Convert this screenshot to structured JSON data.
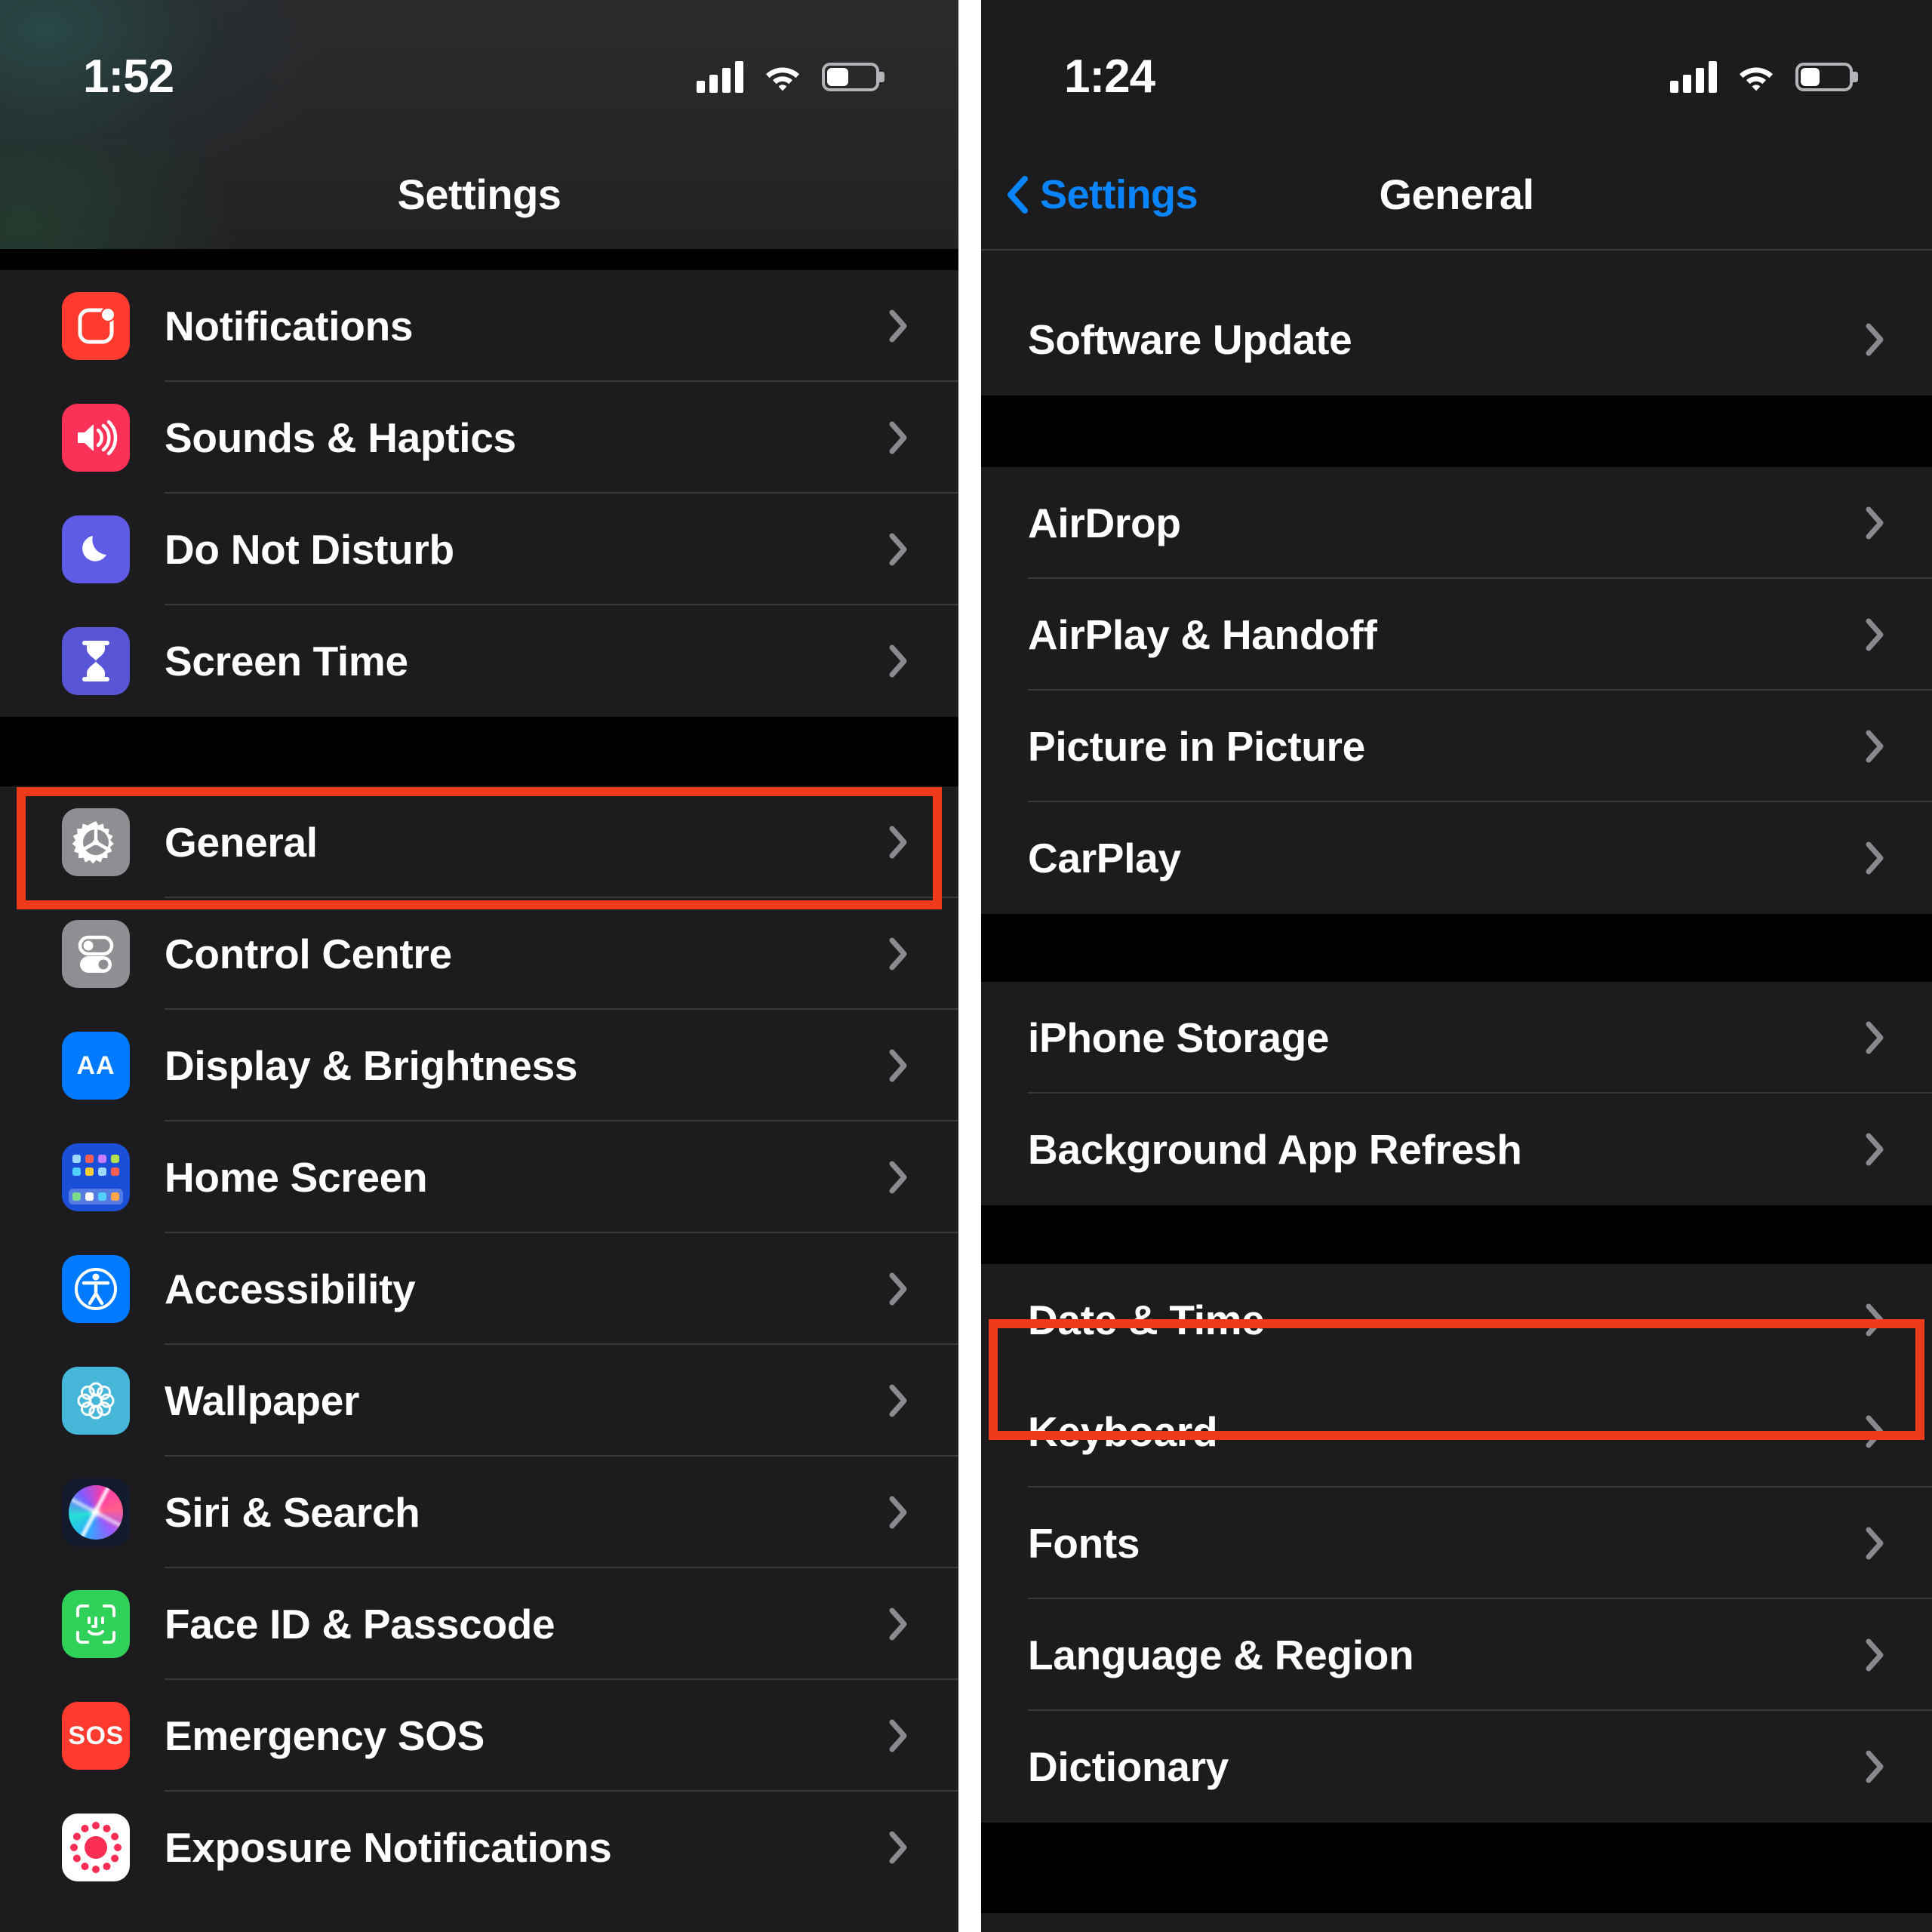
{
  "theme": {
    "accent_blue": "#0a84ff",
    "highlight_red": "#ee3b1c",
    "row_bg": "#1c1c1e",
    "gap_bg": "#000000",
    "label_white": "#ffffff"
  },
  "left_phone": {
    "status_bar": {
      "time": "1:52",
      "cellular": "cellular-bars-icon",
      "wifi": "wifi-icon",
      "battery": "battery-icon",
      "battery_level": 45
    },
    "nav": {
      "title": "Settings"
    },
    "sections": [
      {
        "rows": [
          {
            "label": "Notifications",
            "icon": "notifications-icon",
            "icon_class": "ic-notifications"
          },
          {
            "label": "Sounds & Haptics",
            "icon": "speaker-icon",
            "icon_class": "ic-sounds"
          },
          {
            "label": "Do Not Disturb",
            "icon": "moon-icon",
            "icon_class": "ic-dnd"
          },
          {
            "label": "Screen Time",
            "icon": "hourglass-icon",
            "icon_class": "ic-screentime"
          }
        ]
      },
      {
        "rows": [
          {
            "label": "General",
            "icon": "gear-icon",
            "icon_class": "ic-general",
            "highlighted": true
          },
          {
            "label": "Control Centre",
            "icon": "toggles-icon",
            "icon_class": "ic-control"
          },
          {
            "label": "Display & Brightness",
            "icon": "aa-text-icon",
            "icon_class": "ic-display"
          },
          {
            "label": "Home Screen",
            "icon": "app-grid-icon",
            "icon_class": "ic-homescreen"
          },
          {
            "label": "Accessibility",
            "icon": "accessibility-icon",
            "icon_class": "ic-accessibility"
          },
          {
            "label": "Wallpaper",
            "icon": "flower-icon",
            "icon_class": "ic-wallpaper"
          },
          {
            "label": "Siri & Search",
            "icon": "siri-orb-icon",
            "icon_class": "ic-siri"
          },
          {
            "label": "Face ID & Passcode",
            "icon": "face-id-icon",
            "icon_class": "ic-faceid"
          },
          {
            "label": "Emergency SOS",
            "icon": "sos-icon",
            "icon_class": "ic-sos"
          },
          {
            "label": "Exposure Notifications",
            "icon": "exposure-icon",
            "icon_class": "ic-exposure"
          }
        ]
      }
    ]
  },
  "right_phone": {
    "status_bar": {
      "time": "1:24",
      "cellular": "cellular-bars-icon",
      "wifi": "wifi-icon",
      "battery": "battery-icon",
      "battery_level": 40
    },
    "nav": {
      "back_label": "Settings",
      "title": "General",
      "back_icon": "chevron-left-icon"
    },
    "sections": [
      {
        "rows": [
          {
            "label": "Software Update"
          }
        ]
      },
      {
        "rows": [
          {
            "label": "AirDrop"
          },
          {
            "label": "AirPlay & Handoff"
          },
          {
            "label": "Picture in Picture"
          },
          {
            "label": "CarPlay"
          }
        ]
      },
      {
        "rows": [
          {
            "label": "iPhone Storage"
          },
          {
            "label": "Background App Refresh"
          }
        ]
      },
      {
        "rows": [
          {
            "label": "Date & Time",
            "highlighted": true
          },
          {
            "label": "Keyboard"
          },
          {
            "label": "Fonts"
          },
          {
            "label": "Language & Region"
          },
          {
            "label": "Dictionary"
          }
        ]
      }
    ]
  }
}
